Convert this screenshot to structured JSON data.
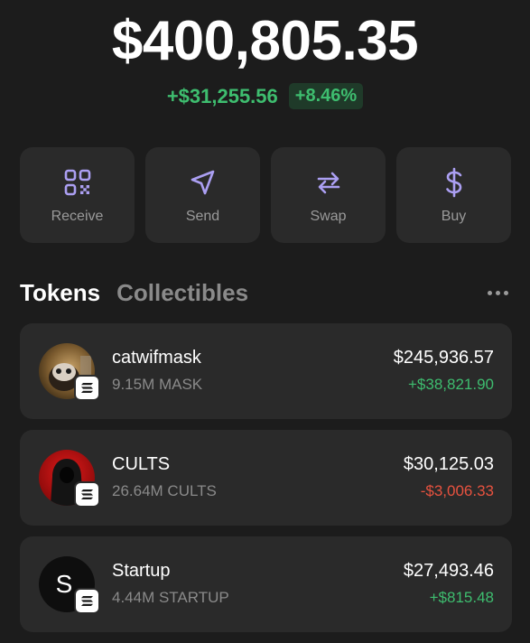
{
  "balance": {
    "total": "$400,805.35",
    "change_amount": "+$31,255.56",
    "change_percent": "+8.46%",
    "change_color": "#3ebd6f"
  },
  "actions": [
    {
      "label": "Receive",
      "icon": "qr-code-icon"
    },
    {
      "label": "Send",
      "icon": "send-arrow-icon"
    },
    {
      "label": "Swap",
      "icon": "swap-arrows-icon"
    },
    {
      "label": "Buy",
      "icon": "dollar-icon"
    }
  ],
  "accent_color": "#ab9ff2",
  "tabs": [
    {
      "label": "Tokens",
      "active": true
    },
    {
      "label": "Collectibles",
      "active": false
    }
  ],
  "tokens": [
    {
      "name": "catwifmask",
      "amount": "9.15M MASK",
      "value": "$245,936.57",
      "change": "+$38,821.90",
      "direction": "positive",
      "chain_icon": "solana-icon"
    },
    {
      "name": "CULTS",
      "amount": "26.64M CULTS",
      "value": "$30,125.03",
      "change": "-$3,006.33",
      "direction": "negative",
      "chain_icon": "solana-icon"
    },
    {
      "name": "Startup",
      "amount": "4.44M STARTUP",
      "value": "$27,493.46",
      "change": "+$815.48",
      "direction": "positive",
      "chain_icon": "solana-icon",
      "avatar_letter": "S"
    }
  ],
  "colors": {
    "positive": "#3ebd6f",
    "negative": "#e8523f",
    "background": "#1c1c1c",
    "card": "#2a2a2a"
  }
}
